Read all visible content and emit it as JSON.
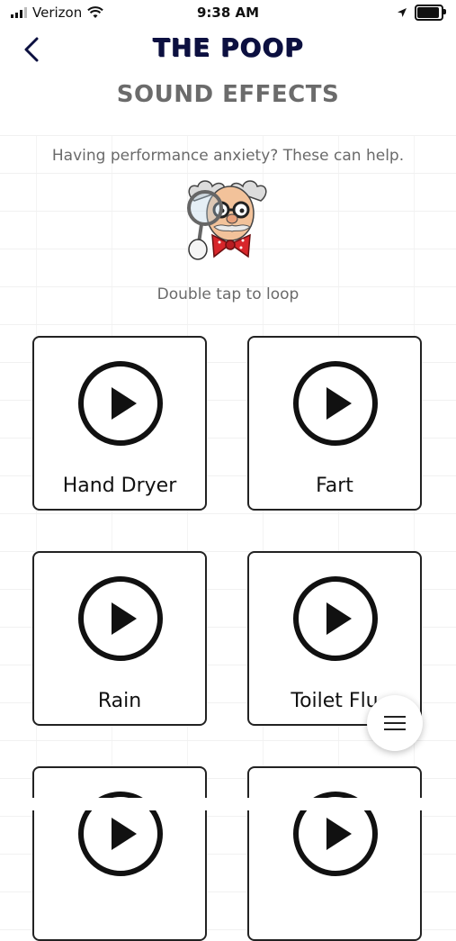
{
  "status_bar": {
    "carrier": "Verizon",
    "time": "9:38 AM"
  },
  "header": {
    "app_title": "THE POOP",
    "page_title": "SOUND EFFECTS"
  },
  "intro": {
    "subtitle": "Having performance anxiety? These can help.",
    "hint": "Double tap to loop"
  },
  "sounds": [
    {
      "label": "Hand Dryer"
    },
    {
      "label": "Fart"
    },
    {
      "label": "Rain"
    },
    {
      "label": "Toilet Flu"
    },
    {
      "label": ""
    },
    {
      "label": ""
    }
  ],
  "icons": [
    "back-chevron-icon",
    "play-icon",
    "hamburger-menu-icon",
    "wifi-icon",
    "location-arrow-icon",
    "battery-icon"
  ],
  "colors": {
    "title_navy": "#0c1040",
    "subtitle_gray": "#6a6a6a",
    "card_border": "#222222"
  }
}
